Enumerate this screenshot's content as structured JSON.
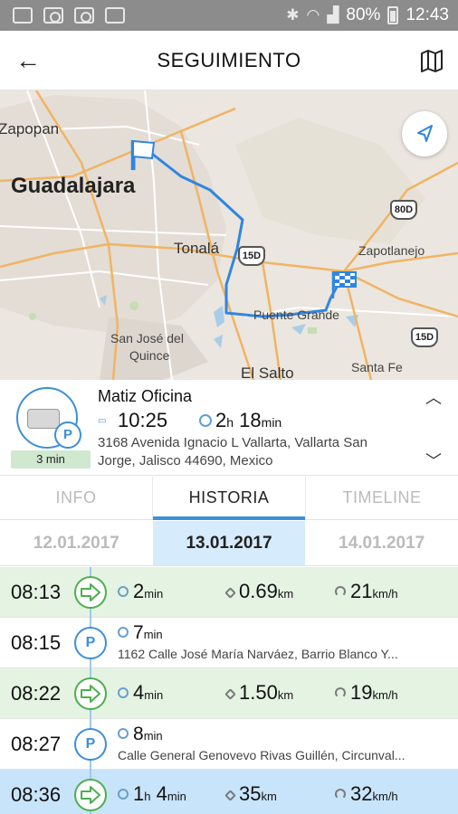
{
  "status_bar": {
    "battery": "80%",
    "time": "12:43"
  },
  "app_bar": {
    "title": "SEGUIMIENTO"
  },
  "map": {
    "labels": {
      "zapopan": "Zapopan",
      "guadalajara": "Guadalajara",
      "tonala": "Tonalá",
      "zapotlanejo": "Zapotlanejo",
      "puente_grande": "Puente Grande",
      "san_jose": "San José del",
      "quince": "Quince",
      "el_salto": "El Salto",
      "santa_fe": "Santa Fe"
    },
    "shields": {
      "s1": "15D",
      "s2": "80D",
      "s3": "15D"
    },
    "colors": {
      "route": "#2f86e0",
      "highway": "#f0a64a",
      "water": "#a9cde8"
    }
  },
  "vehicle": {
    "name": "Matiz Oficina",
    "time": "10:25",
    "stop_hours": "2",
    "stop_hours_unit": "h",
    "stop_minutes": "18",
    "stop_minutes_unit": "min",
    "duration_badge": "3 min",
    "address_line1": "3168 Avenida Ignacio L Vallarta, Vallarta San",
    "address_line2": "Jorge, Jalisco 44690, Mexico"
  },
  "tabs": [
    {
      "label": "INFO"
    },
    {
      "label": "HISTORIA"
    },
    {
      "label": "TIMELINE"
    }
  ],
  "dates": [
    {
      "label": "12.01.2017"
    },
    {
      "label": "13.01.2017"
    },
    {
      "label": "14.01.2017"
    }
  ],
  "entries": [
    {
      "time": "08:13",
      "duration": "2",
      "duration_unit": "min",
      "distance": "0.69",
      "distance_unit": "km",
      "speed": "21",
      "speed_unit": "km/h"
    },
    {
      "time": "08:15",
      "duration": "7",
      "duration_unit": "min",
      "address": "1162 Calle José María Narváez, Barrio Blanco Y..."
    },
    {
      "time": "08:22",
      "duration": "4",
      "duration_unit": "min",
      "distance": "1.50",
      "distance_unit": "km",
      "speed": "19",
      "speed_unit": "km/h"
    },
    {
      "time": "08:27",
      "duration": "8",
      "duration_unit": "min",
      "address": "Calle General Genovevo Rivas Guillén, Circunval..."
    },
    {
      "time": "08:36",
      "duration_h": "1",
      "duration_h_unit": "h",
      "duration": "4",
      "duration_unit": "min",
      "distance": "35",
      "distance_unit": "km",
      "speed": "32",
      "speed_unit": "km/h"
    }
  ],
  "icons": {
    "park_letter": "P"
  }
}
